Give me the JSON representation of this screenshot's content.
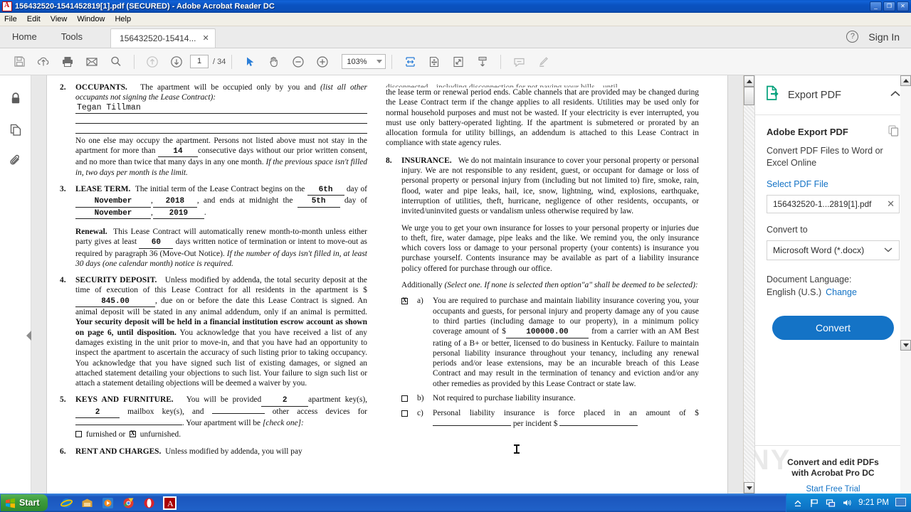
{
  "window": {
    "title": "156432520-1541452819[1].pdf (SECURED) - Adobe Acrobat Reader DC",
    "minimize": "_",
    "maximize": "❐",
    "close": "✕"
  },
  "menubar": {
    "items": [
      "File",
      "Edit",
      "View",
      "Window",
      "Help"
    ]
  },
  "tabstrip": {
    "home": "Home",
    "tools": "Tools",
    "document_tab": "156432520-15414...",
    "tab_close": "✕",
    "help": "?",
    "sign_in": "Sign In"
  },
  "toolbar": {
    "save_icon": "save-icon",
    "upload_icon": "upload-cloud-icon",
    "print_icon": "print-icon",
    "email_icon": "email-icon",
    "search_icon": "search-icon",
    "prev_page_icon": "arrow-up-circle-icon",
    "next_page_icon": "arrow-down-circle-icon",
    "page_number": "1",
    "page_total": "/ 34",
    "select_icon": "cursor-select-icon",
    "hand_icon": "hand-tool-icon",
    "zoom_out_icon": "zoom-out-icon",
    "zoom_in_icon": "zoom-in-icon",
    "zoom_level": "103%",
    "fit_width_icon": "fit-width-icon",
    "pan_zoom_icon": "pan-and-zoom-icon",
    "fullscreen_icon": "fullscreen-icon",
    "scroll_mode_icon": "scroll-mode-icon",
    "comment_icon": "comment-icon",
    "highlight_icon": "highlight-icon"
  },
  "leftrail": {
    "items": [
      {
        "name": "security-lock-icon",
        "label": "Security"
      },
      {
        "name": "page-thumbnails-icon",
        "label": "Page Thumbnails"
      },
      {
        "name": "attachments-paperclip-icon",
        "label": "Attachments"
      }
    ],
    "collapse": "◀"
  },
  "document": {
    "left_column": [
      {
        "num": "2.",
        "title": "OCCUPANTS.",
        "intro": "The apartment will be occupied only by you and",
        "intro_italic": "(list all other occupants not signing the Lease Contract):",
        "handwritten": "Tegan Tillman",
        "after": "No one else may occupy the apartment. Persons not listed above must not stay in the apartment for more than",
        "days": "14",
        "after2": "consecutive days without our prior written consent, and no more than twice that many days in any one month.",
        "after_italic": "If the previous space isn't filled in, two days per month is the limit."
      },
      {
        "num": "3.",
        "title": "LEASE TERM.",
        "t1": "The initial term of the Lease Contract begins on the",
        "begin_day": "6th",
        "t2": "day of",
        "begin_month": "November",
        "begin_year": "2018",
        "t3": ", and ends at midnight the",
        "end_day": "5th",
        "t4": "day of",
        "end_month": "November",
        "end_year": "2019",
        "renewal_title": "Renewal.",
        "renewal_1": "This Lease Contract will automatically renew month-to-month unless either party gives at least",
        "renewal_days": "60",
        "renewal_2": "days written notice of termination or intent to move-out as required by paragraph 36 (Move-Out Notice).",
        "renewal_italic": "If the number of days isn't filled in, at least 30 days (one calendar month) notice is required."
      },
      {
        "num": "4.",
        "title": "SECURITY DEPOSIT.",
        "p1": "Unless modified by addenda, the total security deposit at the time of execution of this Lease Contract for all residents in the apartment is $",
        "amount": "845.00",
        "p2": ", due on or before the date this Lease Contract is signed. An animal deposit will be stated in any animal addendum, only if an animal is permitted.",
        "p3_bold": "Your security deposit will be held in a financial institution escrow account as shown on page 6, until disposition.",
        "p4": "You acknowledge that you have received a list of any damages existing in the unit prior to move-in, and that you have had an opportunity to inspect the apartment to ascertain the accuracy of such listing prior to taking occupancy. You acknowledge that you have signed such list of existing damages, or signed an attached statement detailing your objections to such list. Your failure to sign such list or attach a statement detailing objections will be deemed a waiver by you."
      },
      {
        "num": "5.",
        "title": "KEYS AND FURNITURE.",
        "k1": "You will be provided",
        "apartment_keys": "2",
        "k2": "apartment key(s),",
        "mailbox_keys": "2",
        "k3": "mailbox key(s), and",
        "other_devices": "",
        "k4": "other access devices for",
        "devices_for": "",
        "k5": ". Your apartment will be",
        "k5_italic": "[check one]:",
        "furnished_label": "furnished or",
        "unfurnished_label": "unfurnished.",
        "furnished_checked": false,
        "unfurnished_checked": true
      },
      {
        "num": "6.",
        "title": "RENT AND CHARGES.",
        "p1": "Unless modified by addenda, you will pay"
      }
    ],
    "right_column": {
      "top_cut": "disconnected—including disconnection for not paying your bills—until",
      "top_para": "the lease term or renewal period ends. Cable channels that are provided may be changed during the Lease Contract term if the change applies to all residents.  Utilities may be used only for  normal household purposes and must not be wasted.  If your electricity is ever interrupted, you must use only battery-operated lighting. If the apartment is submetered or prorated by an allocation formula for utility billings, an addendum is attached to this Lease Contract in compliance with state agency rules.",
      "item8": {
        "num": "8.",
        "title": "INSURANCE.",
        "p1": "We do not maintain insurance to cover your personal property or personal injury. We are not responsible to any resident, guest, or occupant for damage or loss of personal property or personal injury from (including but not limited to) fire, smoke, rain, flood, water and pipe leaks, hail, ice, snow, lightning, wind, explosions, earthquake, interruption of utilities, theft, hurricane, negligence of other residents, occupants, or invited/uninvited guests or vandalism unless otherwise required by law.",
        "p2": "We urge you to get your own insurance for losses to your personal property or injuries due to theft, fire, water damage, pipe leaks and the like. We remind you, the only insurance which covers loss or damage to your personal property (your contents) is insurance you purchase yourself. Contents insurance may be available as part of a liability insurance policy offered for purchase through our office.",
        "additionally": "Additionally",
        "additionally_italic": "(Select one. If none is selected then option\"a\" shall be deemed to be selected):",
        "options": [
          {
            "letter": "a)",
            "checked": true,
            "text1": "You are required to purchase and maintain liability insurance covering you, your occupants and guests, for personal injury and property damage any of you cause to third parties (including damage to our property), in a minimum policy coverage amount of $",
            "amount": "100000.00",
            "text2": "from a carrier with an AM Best rating of a B+ or better, licensed to do business in Kentucky. Failure to maintain personal liability insurance throughout your tenancy, including any renewal periods and/or lease extensions, may be an incurable breach of this Lease Contract and may result in the termination of tenancy and eviction and/or any other remedies as provided by this Lease Contract or state law."
          },
          {
            "letter": "b)",
            "checked": false,
            "text1": "Not required to purchase liability insurance.",
            "amount": "",
            "text2": ""
          },
          {
            "letter": "c)",
            "checked": false,
            "text1": "Personal liability insurance is force placed in an amount of $",
            "amount": "",
            "text2": "per incident $"
          }
        ]
      }
    }
  },
  "right_panel": {
    "header_title": "Export PDF",
    "header_icon": "export-pdf-icon",
    "collapse_icon": "chevron-up-icon",
    "h2": "Adobe Export PDF",
    "stack_icon": "document-stack-icon",
    "description": "Convert PDF Files to Word or Excel Online",
    "select_file_link": "Select PDF File",
    "file_name": "156432520-1...2819[1].pdf",
    "file_remove": "✕",
    "convert_to_label": "Convert to",
    "convert_to_value": "Microsoft Word (*.docx)",
    "language_label": "Document Language:",
    "language_value": "English (U.S.)",
    "language_change": "Change",
    "convert_button": "Convert",
    "footer_line1": "Convert and edit PDFs",
    "footer_line2": "with Acrobat Pro DC",
    "footer_link": "Start Free Trial",
    "watermark": "ANY",
    "accent_color": "#1473c6"
  },
  "taskbar": {
    "start": "Start",
    "quicklaunch": [
      {
        "name": "internet-explorer-icon"
      },
      {
        "name": "show-desktop-icon"
      },
      {
        "name": "media-player-icon"
      },
      {
        "name": "chrome-icon"
      },
      {
        "name": "opera-icon"
      },
      {
        "name": "acrobat-reader-icon"
      }
    ],
    "tray_icons": [
      {
        "name": "show-hidden-icons-icon"
      },
      {
        "name": "flag-security-icon"
      },
      {
        "name": "network-icon"
      },
      {
        "name": "volume-icon"
      }
    ],
    "clock": "9:21 PM",
    "show_desktop": "show-desktop-icon"
  }
}
